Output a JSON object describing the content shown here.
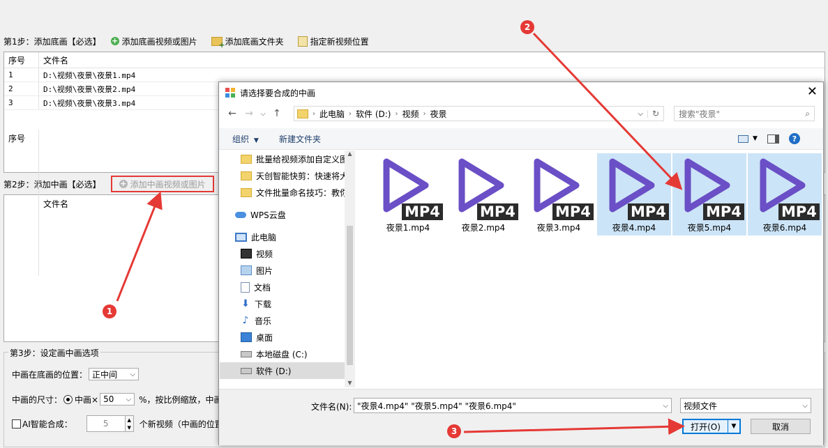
{
  "step1": {
    "title": "第1步：添加底画【必选】",
    "btn_add": "添加底画视频或图片",
    "btn_folder": "添加底画文件夹",
    "btn_location": "指定新视频位置",
    "columns": [
      "序号",
      "文件名"
    ],
    "rows": [
      {
        "no": "1",
        "file": "D:\\视频\\夜景\\夜景1.mp4"
      },
      {
        "no": "2",
        "file": "D:\\视频\\夜景\\夜景2.mp4"
      },
      {
        "no": "3",
        "file": "D:\\视频\\夜景\\夜景3.mp4"
      }
    ]
  },
  "step2": {
    "title": "第2步：添加中画【必选】",
    "btn_add": "添加中画视频或图片",
    "columns": [
      "序号",
      "文件名"
    ]
  },
  "step3": {
    "title": "第3步：设定画中画选项",
    "position_label": "中画在底画的位置：",
    "position_value": "正中间",
    "size_label": "中画的尺寸：",
    "size_radio": "中画×",
    "size_value": "50",
    "size_suffix": "%，按比例缩放，中画",
    "ai_label": "AI智能合成：",
    "ai_value": "5",
    "ai_suffix": "个新视频（中画的位置和"
  },
  "dialog": {
    "title": "请选择要合成的中画",
    "breadcrumb": [
      "此电脑",
      "软件 (D:)",
      "视频",
      "夜景"
    ],
    "search_placeholder": "搜索\"夜景\"",
    "organize": "组织",
    "new_folder": "新建文件夹",
    "nav_items": [
      {
        "label": "批量给视频添加自定义图",
        "icon": "folder-icon"
      },
      {
        "label": "天创智能快剪：快速将大",
        "icon": "folder-icon"
      },
      {
        "label": "文件批量命名技巧：教你",
        "icon": "folder-icon"
      },
      {
        "label": "WPS云盘",
        "icon": "cloud-icon"
      },
      {
        "label": "此电脑",
        "icon": "computer-icon"
      },
      {
        "label": "视频",
        "icon": "video-folder-icon"
      },
      {
        "label": "图片",
        "icon": "picture-folder-icon"
      },
      {
        "label": "文档",
        "icon": "document-folder-icon"
      },
      {
        "label": "下载",
        "icon": "download-folder-icon"
      },
      {
        "label": "音乐",
        "icon": "music-folder-icon"
      },
      {
        "label": "桌面",
        "icon": "desktop-folder-icon"
      },
      {
        "label": "本地磁盘 (C:)",
        "icon": "drive-icon"
      },
      {
        "label": "软件 (D:)",
        "icon": "drive-icon"
      }
    ],
    "files": [
      {
        "name": "夜景1.mp4",
        "badge": "MP4",
        "selected": false
      },
      {
        "name": "夜景2.mp4",
        "badge": "MP4",
        "selected": false
      },
      {
        "name": "夜景3.mp4",
        "badge": "MP4",
        "selected": false
      },
      {
        "name": "夜景4.mp4",
        "badge": "MP4",
        "selected": true
      },
      {
        "name": "夜景5.mp4",
        "badge": "MP4",
        "selected": true
      },
      {
        "name": "夜景6.mp4",
        "badge": "MP4",
        "selected": true
      }
    ],
    "filename_label": "文件名(N):",
    "filename_value": "\"夜景4.mp4\" \"夜景5.mp4\" \"夜景6.mp4\"",
    "filetype_value": "视频文件",
    "open_label": "打开(O)",
    "cancel_label": "取消"
  },
  "annotations": {
    "marker1": "1",
    "marker2": "2",
    "marker3": "3",
    "color": "#e53935"
  },
  "colors": {
    "play_icon": "#6a4fc6",
    "selection": "#cce4f7",
    "accent": "#0078d7"
  }
}
